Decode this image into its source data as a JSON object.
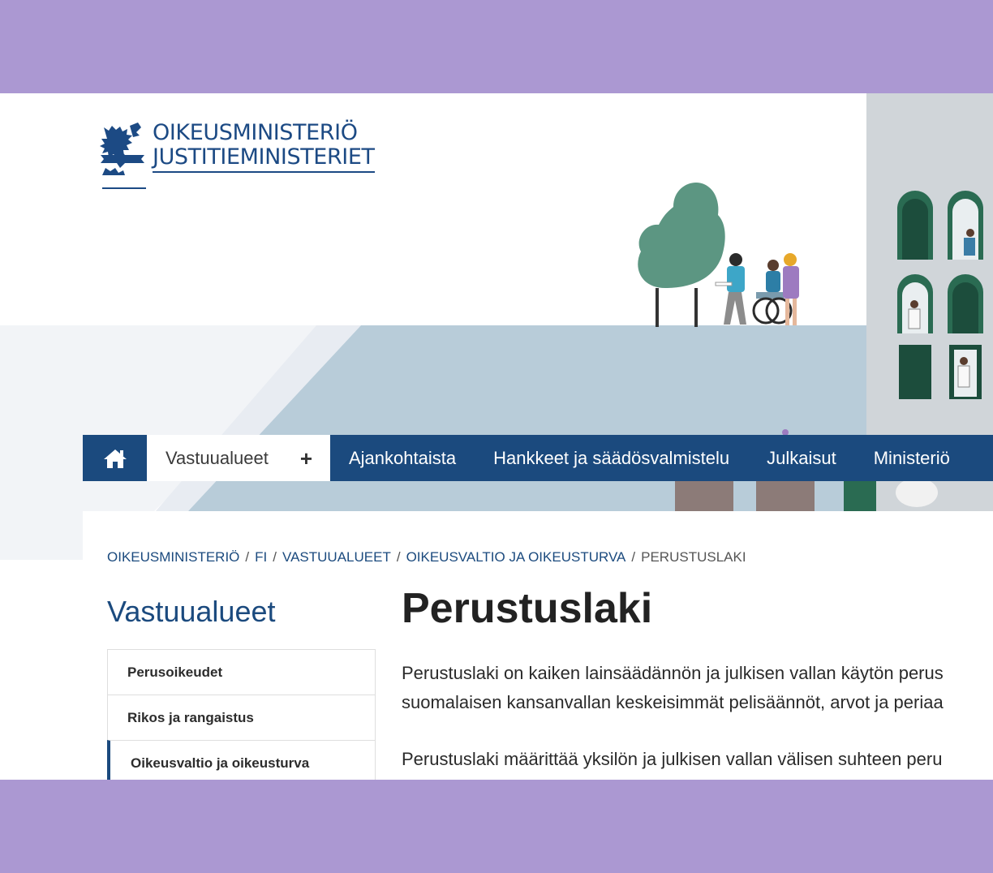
{
  "colors": {
    "brand": "#1b4a7e",
    "frame": "#ab98d2"
  },
  "logo": {
    "line1": "OIKEUSMINISTERIÖ",
    "line2": "JUSTITIEMINISTERIET",
    "emblem": "lion-emblem-icon"
  },
  "nav": {
    "home_icon": "home-icon",
    "active_label": "Vastuualueet",
    "expand_icon": "+",
    "items": [
      "Ajankohtaista",
      "Hankkeet ja säädösvalmistelu",
      "Julkaisut",
      "Ministeriö"
    ]
  },
  "breadcrumb": {
    "items": [
      "OIKEUSMINISTERIÖ",
      "FI",
      "VASTUUALUEET",
      "OIKEUSVALTIO JA OIKEUSTURVA"
    ],
    "separator": "/",
    "current": "PERUSTUSLAKI"
  },
  "sidebar": {
    "title": "Vastuualueet",
    "items": [
      "Perusoikeudet",
      "Rikos ja rangaistus",
      "Oikeusvaltio ja oikeusturva"
    ]
  },
  "main": {
    "title": "Perustuslaki",
    "para1_line1": "Perustuslaki on kaiken lainsäädännön ja julkisen vallan käytön perus",
    "para1_line2": "suomalaisen kansanvallan keskeisimmät pelisäännöt, arvot ja periaa",
    "para2_line1": "Perustuslaki määrittää yksilön ja julkisen vallan välisen suhteen peru"
  }
}
